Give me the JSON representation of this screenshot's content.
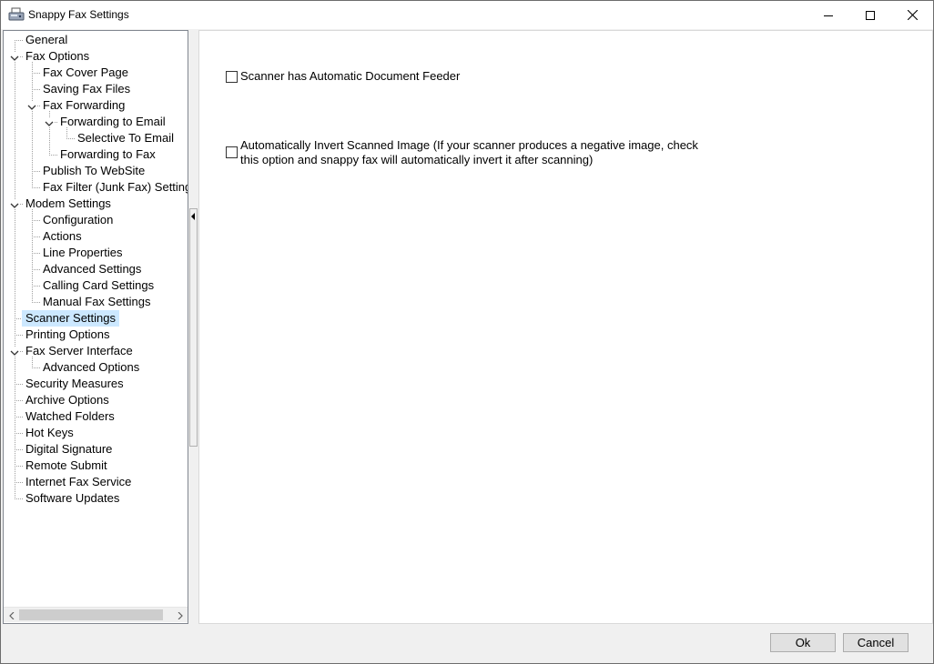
{
  "window": {
    "title": "Snappy Fax Settings",
    "icon": "fax-machine-icon"
  },
  "tree": {
    "items": [
      {
        "label": "General",
        "level": 0,
        "expanded": null
      },
      {
        "label": "Fax Options",
        "level": 0,
        "expanded": true
      },
      {
        "label": "Fax Cover Page",
        "level": 1,
        "expanded": null
      },
      {
        "label": "Saving Fax Files",
        "level": 1,
        "expanded": null
      },
      {
        "label": "Fax Forwarding",
        "level": 1,
        "expanded": true
      },
      {
        "label": "Forwarding to Email",
        "level": 2,
        "expanded": true
      },
      {
        "label": "Selective To Email",
        "level": 3,
        "expanded": null
      },
      {
        "label": "Forwarding to Fax",
        "level": 2,
        "expanded": null
      },
      {
        "label": "Publish To WebSite",
        "level": 1,
        "expanded": null
      },
      {
        "label": "Fax Filter (Junk Fax) Settings",
        "level": 1,
        "expanded": null
      },
      {
        "label": "Modem Settings",
        "level": 0,
        "expanded": true
      },
      {
        "label": "Configuration",
        "level": 1,
        "expanded": null
      },
      {
        "label": "Actions",
        "level": 1,
        "expanded": null
      },
      {
        "label": "Line Properties",
        "level": 1,
        "expanded": null
      },
      {
        "label": "Advanced Settings",
        "level": 1,
        "expanded": null
      },
      {
        "label": "Calling Card Settings",
        "level": 1,
        "expanded": null
      },
      {
        "label": "Manual Fax Settings",
        "level": 1,
        "expanded": null
      },
      {
        "label": "Scanner Settings",
        "level": 0,
        "expanded": null,
        "selected": true
      },
      {
        "label": "Printing Options",
        "level": 0,
        "expanded": null
      },
      {
        "label": "Fax Server Interface",
        "level": 0,
        "expanded": true
      },
      {
        "label": "Advanced Options",
        "level": 1,
        "expanded": null
      },
      {
        "label": "Security Measures",
        "level": 0,
        "expanded": null
      },
      {
        "label": "Archive Options",
        "level": 0,
        "expanded": null
      },
      {
        "label": "Watched Folders",
        "level": 0,
        "expanded": null
      },
      {
        "label": "Hot Keys",
        "level": 0,
        "expanded": null
      },
      {
        "label": "Digital Signature",
        "level": 0,
        "expanded": null
      },
      {
        "label": "Remote Submit",
        "level": 0,
        "expanded": null
      },
      {
        "label": "Internet Fax Service",
        "level": 0,
        "expanded": null
      },
      {
        "label": "Software Updates",
        "level": 0,
        "expanded": null
      }
    ]
  },
  "scanner": {
    "adf_label": "Scanner has Automatic Document Feeder",
    "adf_checked": false,
    "invert_label": "Automatically Invert Scanned Image  (If your scanner produces a negative image, check this option and snappy fax will automatically invert it after scanning)",
    "invert_checked": false
  },
  "buttons": {
    "ok": "Ok",
    "cancel": "Cancel"
  }
}
